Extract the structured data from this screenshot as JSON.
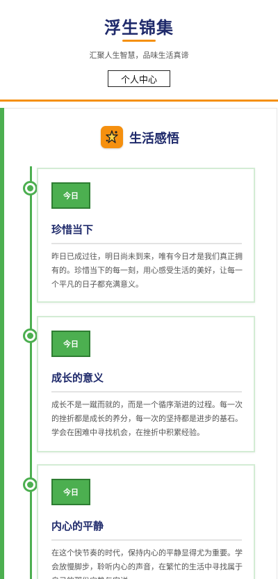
{
  "header": {
    "title": "浮生锦集",
    "subtitle": "汇聚人生智慧，品味生活真谛",
    "profile_button": "个人中心"
  },
  "section": {
    "title": "生活感悟",
    "icon": "sparkle-icon",
    "colors": {
      "accent_green": "#4caf50",
      "accent_orange": "#f5900f",
      "title_navy": "#1f2a6b"
    }
  },
  "posts": [
    {
      "badge": "今日",
      "title": "珍惜当下",
      "body": "昨日已成过往，明日尚未到来，唯有今日才是我们真正拥有的。珍惜当下的每一刻，用心感受生活的美好，让每一个平凡的日子都充满意义。"
    },
    {
      "badge": "今日",
      "title": "成长的意义",
      "body": "成长不是一蹴而就的，而是一个循序渐进的过程。每一次的挫折都是成长的养分，每一次的坚持都是进步的基石。学会在困难中寻找机会，在挫折中积累经验。"
    },
    {
      "badge": "今日",
      "title": "内心的平静",
      "body": "在这个快节奏的时代，保持内心的平静显得尤为重要。学会放慢脚步，聆听内心的声音，在繁忙的生活中寻找属于自己的那份宁静与安详。"
    }
  ]
}
